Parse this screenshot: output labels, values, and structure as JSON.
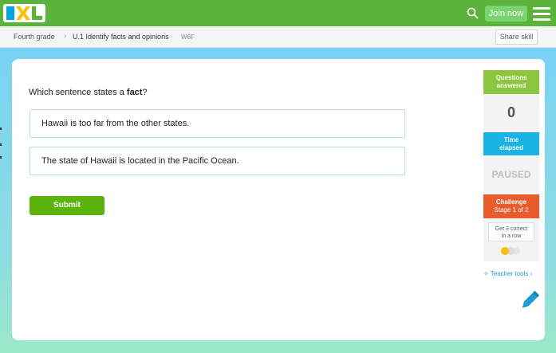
{
  "header": {
    "join_label": "Join now"
  },
  "breadcrumb": {
    "grade": "Fourth grade",
    "separator": "›",
    "skill": "U.1 Identify facts and opinions",
    "code": "W6F",
    "share_label": "Share skill"
  },
  "question": {
    "prefix": "Which sentence states a ",
    "emphasis": "fact",
    "suffix": "?",
    "choices": [
      "Hawaii is too far from the other states.",
      "The state of Hawaii is located in the Pacific Ocean."
    ],
    "submit_label": "Submit"
  },
  "sidebar": {
    "questions_line1": "Questions",
    "questions_line2": "answered",
    "questions_value": "0",
    "time_line1": "Time",
    "time_line2": "elapsed",
    "time_value": "PAUSED",
    "challenge_line1": "Challenge",
    "challenge_line2": "Stage 1 of 2",
    "challenge_note_line1": "Get 3 correct",
    "challenge_note_line2": "in a row",
    "teacher_tools": "Teacher tools ›"
  },
  "colors": {
    "brand_green": "#5ab43c",
    "questions_green": "#8cc63f",
    "time_blue": "#19b3e6",
    "challenge_orange": "#e85c2c",
    "dot_active": "#f4c010",
    "dot_inactive": "#dcdcdc"
  }
}
